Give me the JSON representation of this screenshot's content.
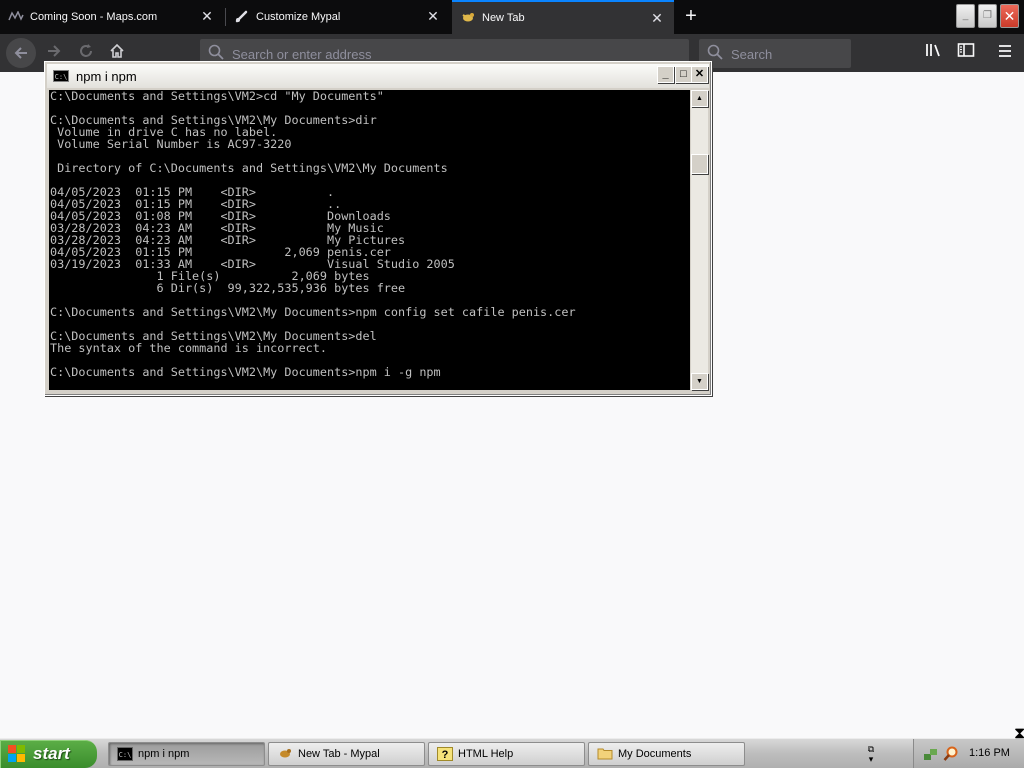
{
  "browser": {
    "tabs": [
      {
        "label": "Coming Soon - Maps.com",
        "icon": "maps-favicon",
        "active": false
      },
      {
        "label": "Customize Mypal",
        "icon": "brush-icon",
        "active": false
      },
      {
        "label": "New Tab",
        "icon": "mypal-favicon",
        "active": true
      }
    ],
    "url_placeholder": "Search or enter address",
    "search_placeholder": "Search",
    "accent": "#0a84ff"
  },
  "console": {
    "title": "npm i npm",
    "lines": [
      "C:\\Documents and Settings\\VM2>cd \"My Documents\"",
      "",
      "C:\\Documents and Settings\\VM2\\My Documents>dir",
      " Volume in drive C has no label.",
      " Volume Serial Number is AC97-3220",
      "",
      " Directory of C:\\Documents and Settings\\VM2\\My Documents",
      "",
      "04/05/2023  01:15 PM    <DIR>          .",
      "04/05/2023  01:15 PM    <DIR>          ..",
      "04/05/2023  01:08 PM    <DIR>          Downloads",
      "03/28/2023  04:23 AM    <DIR>          My Music",
      "03/28/2023  04:23 AM    <DIR>          My Pictures",
      "04/05/2023  01:15 PM             2,069 penis.cer",
      "03/19/2023  01:33 AM    <DIR>          Visual Studio 2005",
      "               1 File(s)          2,069 bytes",
      "               6 Dir(s)  99,322,535,936 bytes free",
      "",
      "C:\\Documents and Settings\\VM2\\My Documents>npm config set cafile penis.cer",
      "",
      "C:\\Documents and Settings\\VM2\\My Documents>del",
      "The syntax of the command is incorrect.",
      "",
      "C:\\Documents and Settings\\VM2\\My Documents>npm i -g npm"
    ]
  },
  "taskbar": {
    "start_label": "start",
    "tasks": [
      {
        "label": "npm i npm",
        "icon": "console-icon",
        "active": true
      },
      {
        "label": "New Tab - Mypal",
        "icon": "mypal-icon",
        "active": false
      },
      {
        "label": "HTML Help",
        "icon": "help-icon",
        "active": false
      },
      {
        "label": "My Documents",
        "icon": "folder-icon",
        "active": false
      }
    ],
    "clock": "1:16 PM"
  }
}
